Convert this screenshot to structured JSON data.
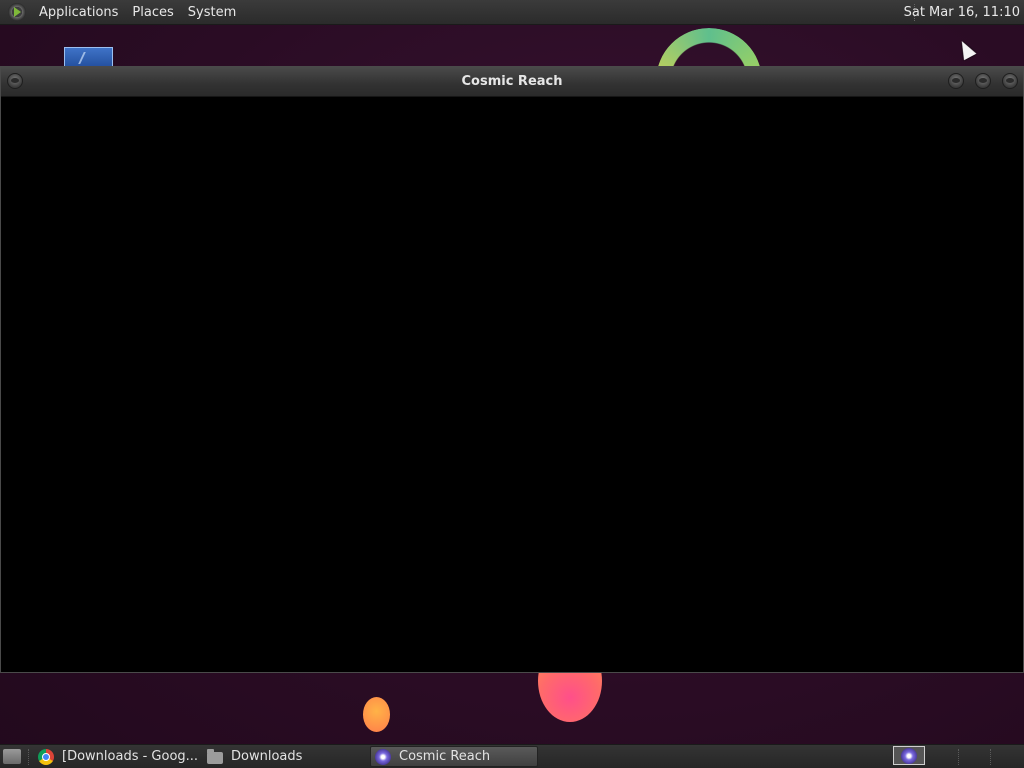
{
  "top_panel": {
    "menus": [
      "Applications",
      "Places",
      "System"
    ],
    "clock": "Sat Mar 16, 11:10"
  },
  "window": {
    "title": "Cosmic Reach"
  },
  "taskbar": {
    "tasks": [
      {
        "label": "[Downloads - Goog...",
        "icon": "chrome-icon",
        "active": false
      },
      {
        "label": "Downloads",
        "icon": "folder-icon",
        "active": false
      },
      {
        "label": "Cosmic Reach",
        "icon": "cosmic-reach-icon",
        "active": true
      }
    ]
  },
  "icons": {
    "menu_logo": "applications-logo-icon",
    "show_desktop": "show-desktop-icon",
    "tray": "cosmic-reach-tray-icon"
  }
}
